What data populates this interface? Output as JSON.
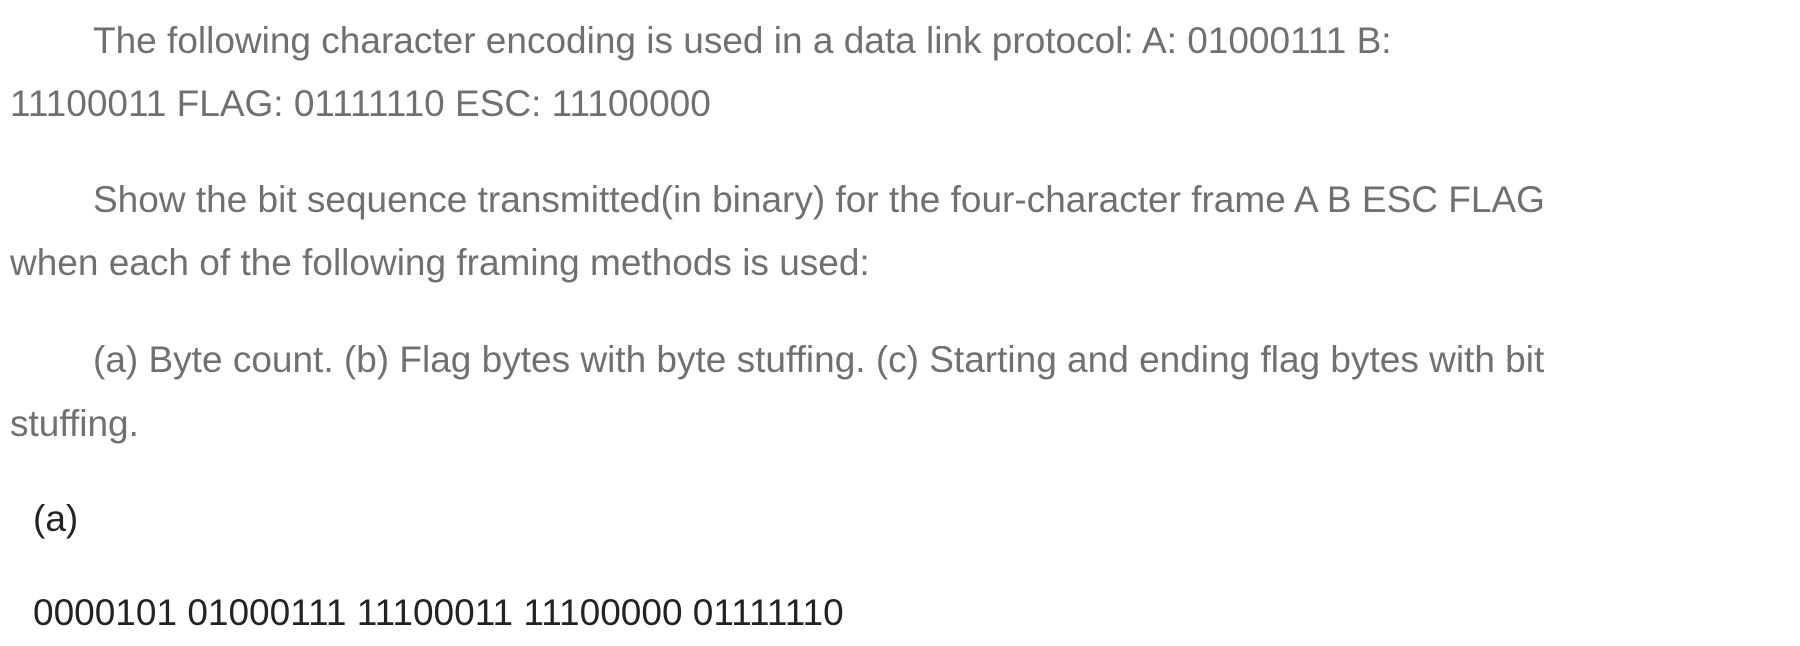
{
  "question": {
    "paragraph1": {
      "lines": [
        "The following character encoding is used in a data link protocol: A: 01000111 B:",
        "11100011 FLAG: 01111110 ESC: 11100000"
      ]
    },
    "paragraph2": {
      "lines": [
        "Show the bit sequence transmitted(in binary) for the four-character frame A B ESC FLAG",
        "when each of the following framing methods is used:"
      ]
    },
    "paragraph3": {
      "lines": [
        "(a) Byte count. (b) Flag bytes with byte stuffing. (c) Starting and ending flag bytes with bit",
        "stuffing."
      ]
    }
  },
  "answer": {
    "label": "(a)",
    "value": "0000101 01000111 11100011 11100000 01111110"
  },
  "colors": {
    "question_text": "#707070",
    "answer_text": "#232323"
  }
}
